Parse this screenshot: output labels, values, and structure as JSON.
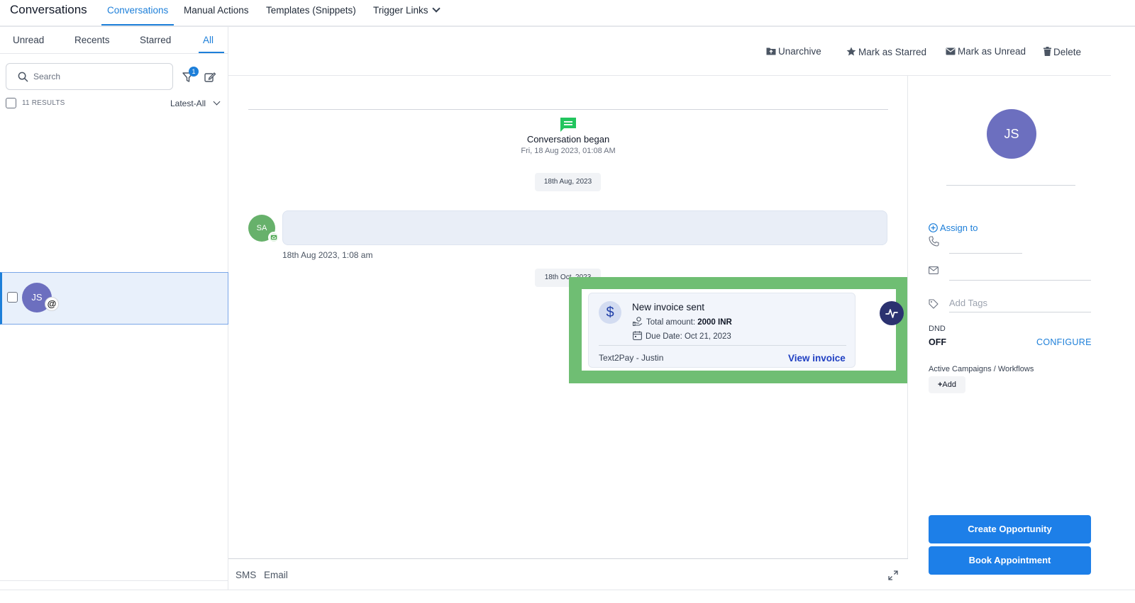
{
  "topbar": {
    "app_title": "Conversations",
    "tabs": [
      {
        "label": "Conversations",
        "active": true
      },
      {
        "label": "Manual Actions"
      },
      {
        "label": "Templates (Snippets)"
      },
      {
        "label": "Trigger Links"
      }
    ]
  },
  "left": {
    "filters": [
      "Unread",
      "Recents",
      "Starred",
      "All"
    ],
    "active_filter": "All",
    "search": {
      "placeholder": "Search"
    },
    "filter_badge": "1",
    "results_count": "11 RESULTS",
    "sort": "Latest-All",
    "conversation": {
      "initials": "JS",
      "badge": "@"
    }
  },
  "toolbar": {
    "unarchive": "Unarchive",
    "mark_starred": "Mark as Starred",
    "mark_unread": "Mark as Unread",
    "delete": "Delete"
  },
  "thread": {
    "began_title": "Conversation began",
    "began_date": "Fri, 18 Aug 2023, 01:08 AM",
    "chip_1": "18th Aug, 2023",
    "sender_initials": "SA",
    "message_time": "18th Aug 2023, 1:08 am",
    "chip_2": "18th Oct, 2023",
    "invoice": {
      "title": "New invoice sent",
      "amount_label": "Total amount: ",
      "amount_value": "2000 INR",
      "due_date": "Due Date: Oct 21, 2023",
      "from": "Text2Pay - Justin",
      "link": "View invoice",
      "currency_symbol": "$"
    }
  },
  "composer": {
    "tabs": [
      "SMS",
      "Email"
    ]
  },
  "contact": {
    "initials": "JS",
    "assign_to": "Assign to",
    "tags_placeholder": "Add Tags",
    "dnd_label": "DND",
    "dnd_value": "OFF",
    "configure": "CONFIGURE",
    "campaigns_label": "Active Campaigns / Workflows",
    "add_label": "Add",
    "create_opportunity": "Create Opportunity",
    "book_appointment": "Book Appointment"
  },
  "colors": {
    "accent": "#1d7fd9",
    "primary_button": "#1d7fe8",
    "highlight": "#6fbe73",
    "avatar_purple": "#6c6fbf",
    "avatar_green": "#67b16b"
  }
}
